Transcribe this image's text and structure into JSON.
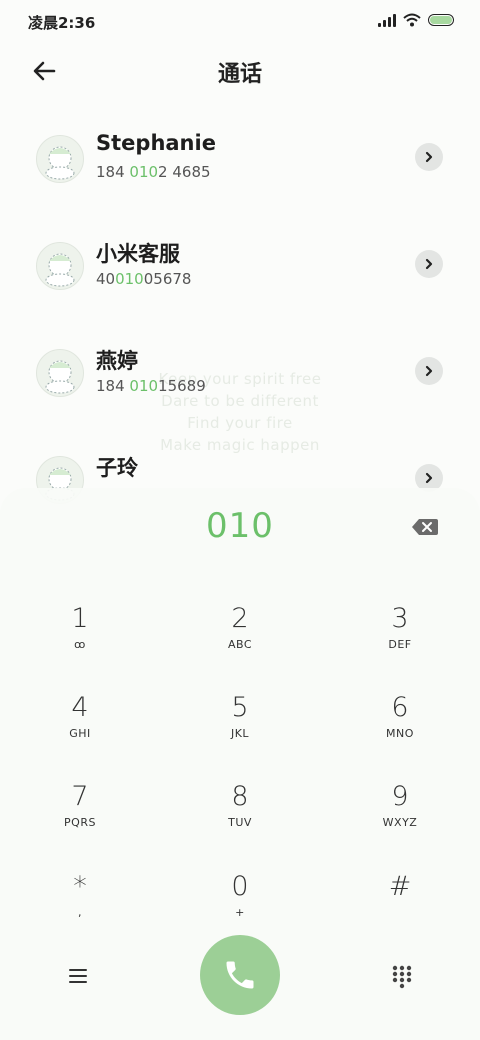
{
  "status_bar": {
    "time": "凌晨2:36",
    "icons": [
      "signal-icon",
      "wifi-icon",
      "battery-icon"
    ],
    "battery_level": 1.0
  },
  "header": {
    "title": "通话",
    "back_icon": "arrow-left-icon"
  },
  "contacts": [
    {
      "name": "Stephanie",
      "number_pre": "184 ",
      "number_match": "010",
      "number_post": "2 4685"
    },
    {
      "name": "小米客服",
      "number_pre": "40",
      "number_match": "010",
      "number_post": "05678"
    },
    {
      "name": "燕婷",
      "number_pre": "184 ",
      "number_match": "010",
      "number_post": "15689"
    },
    {
      "name": "子玲",
      "number_pre": "",
      "number_match": "",
      "number_post": ""
    }
  ],
  "dialer": {
    "input": "010",
    "keys": [
      {
        "digit": "1",
        "letters": "ꝏ"
      },
      {
        "digit": "2",
        "letters": "ABC"
      },
      {
        "digit": "3",
        "letters": "DEF"
      },
      {
        "digit": "4",
        "letters": "GHI"
      },
      {
        "digit": "5",
        "letters": "JKL"
      },
      {
        "digit": "6",
        "letters": "MNO"
      },
      {
        "digit": "7",
        "letters": "PQRS"
      },
      {
        "digit": "8",
        "letters": "TUV"
      },
      {
        "digit": "9",
        "letters": "WXYZ"
      },
      {
        "digit": "*",
        "letters": ","
      },
      {
        "digit": "0",
        "letters": "+"
      },
      {
        "digit": "#",
        "letters": ""
      }
    ]
  },
  "wallpaper_text": [
    "Keep your spirit free",
    "Dare to be different",
    "Find your fire",
    "Make magic happen"
  ],
  "colors": {
    "accent_green": "#6cc06a",
    "call_button": "#9ccf96",
    "background": "#fbfcfa"
  }
}
